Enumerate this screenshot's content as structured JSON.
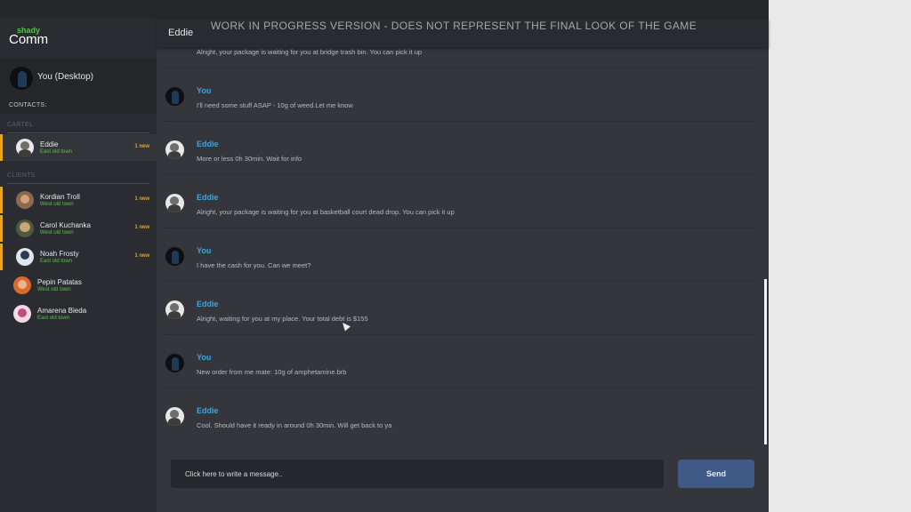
{
  "app": {
    "logo_small": "shady",
    "logo_big": "Comm"
  },
  "banner": "WORK IN PROGRESS VERSION - DOES NOT REPRESENT THE FINAL LOOK OF THE GAME",
  "me": {
    "name": "You (Desktop)"
  },
  "contacts_label": "CONTACTS:",
  "groups": [
    {
      "label": "CARTEL",
      "contacts": [
        {
          "name": "Eddie",
          "location": "East old town",
          "badge": "1 new"
        }
      ]
    },
    {
      "label": "CLIENTS",
      "contacts": [
        {
          "name": "Kordian Troll",
          "location": "West old town",
          "badge": "1 new"
        },
        {
          "name": "Carol Kuchanka",
          "location": "West old town",
          "badge": "1 new"
        },
        {
          "name": "Noah Frosty",
          "location": "East old town",
          "badge": "1 new"
        },
        {
          "name": "Pepin Patatas",
          "location": "West old town",
          "badge": ""
        },
        {
          "name": "Amarena Bieda",
          "location": "East old town",
          "badge": ""
        }
      ]
    }
  ],
  "chat": {
    "title": "Eddie",
    "messages": [
      {
        "sender": "",
        "text": "Alright, your package is waiting for you at bridge trash bin. You can pick it up"
      },
      {
        "sender": "You",
        "text": "I'll need some stuff ASAP - 10g of weed.Let me know"
      },
      {
        "sender": "Eddie",
        "text": "More or less 0h 30min. Wait for info"
      },
      {
        "sender": "Eddie",
        "text": "Alright, your package is waiting for you at basketball court dead drop. You can pick it up"
      },
      {
        "sender": "You",
        "text": "I have the cash for you. Can we meet?"
      },
      {
        "sender": "Eddie",
        "text": "Alright, waiting for you at my place. Your total debt is $155"
      },
      {
        "sender": "You",
        "text": "New order from me mate: 10g of amphetamine.brb"
      },
      {
        "sender": "Eddie",
        "text": "Cool. Should have it ready in around 0h 30min. Will get back to ya"
      }
    ]
  },
  "composer": {
    "placeholder": "Click here to write a message..",
    "send_label": "Send"
  },
  "colors": {
    "accent_blue": "#3fa3e3",
    "unread_orange": "#e9a321",
    "location_green": "#56c24a",
    "send_button": "#3f5a87"
  }
}
